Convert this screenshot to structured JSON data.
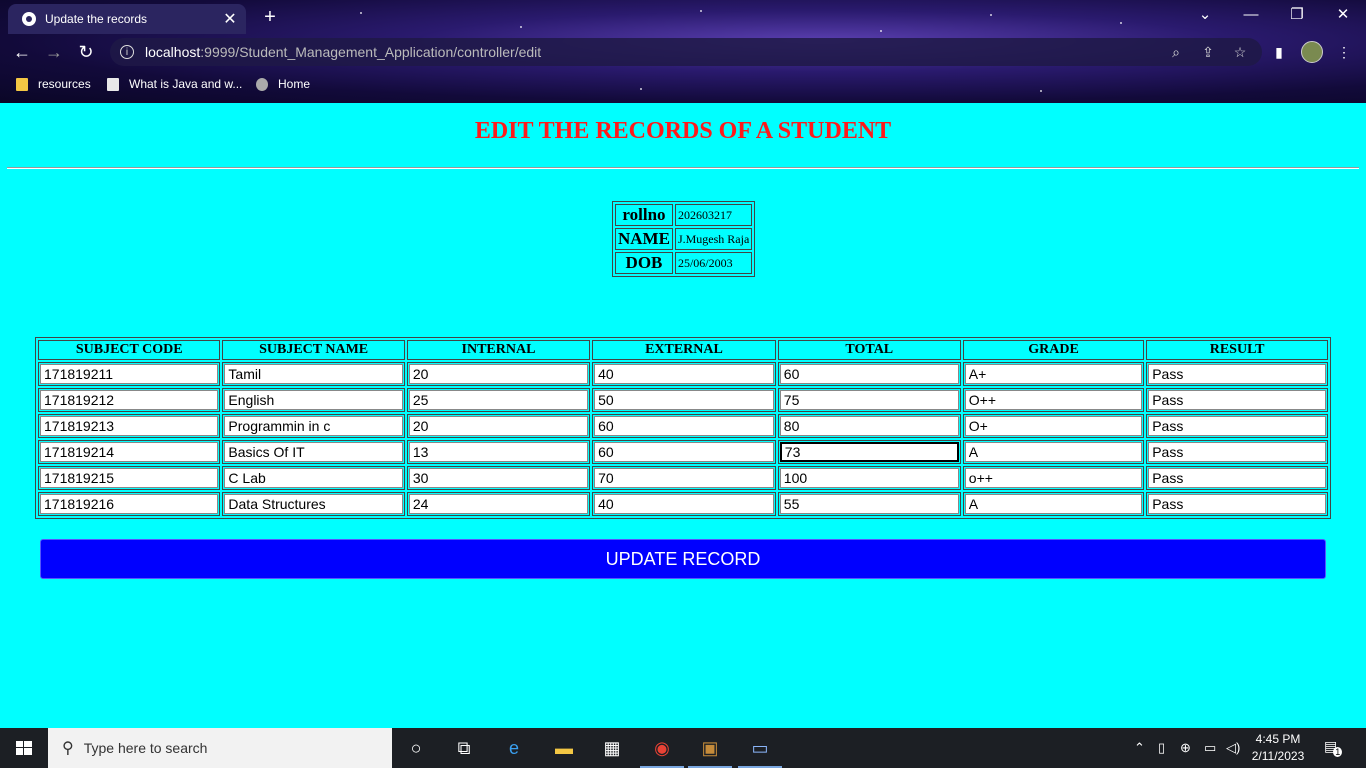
{
  "browser": {
    "tab_title": "Update the records",
    "url_host": "localhost",
    "url_rest": ":9999/Student_Management_Application/controller/edit",
    "bookmarks": [
      "resources",
      "What is Java and w...",
      "Home"
    ]
  },
  "page": {
    "heading": "EDIT THE RECORDS OF A STUDENT",
    "student": [
      {
        "label": "rollno",
        "value": "202603217"
      },
      {
        "label": "NAME",
        "value": "J.Mugesh Raja"
      },
      {
        "label": "DOB",
        "value": "25/06/2003"
      }
    ],
    "columns": [
      "SUBJECT CODE",
      "SUBJECT NAME",
      "INTERNAL",
      "EXTERNAL",
      "TOTAL",
      "GRADE",
      "RESULT"
    ],
    "rows": [
      [
        "171819211",
        "Tamil",
        "20",
        "40",
        "60",
        "A+",
        "Pass"
      ],
      [
        "171819212",
        "English",
        "25",
        "50",
        "75",
        "O++",
        "Pass"
      ],
      [
        "171819213",
        "Programmin in c",
        "20",
        "60",
        "80",
        "O+",
        "Pass"
      ],
      [
        "171819214",
        "Basics Of IT",
        "13",
        "60",
        "73",
        "A",
        "Pass"
      ],
      [
        "171819215",
        "C Lab",
        "30",
        "70",
        "100",
        "o++",
        "Pass"
      ],
      [
        "171819216",
        "Data Structures",
        "24",
        "40",
        "55",
        "A",
        "Pass"
      ]
    ],
    "button_label": "UPDATE RECORD"
  },
  "taskbar": {
    "search_placeholder": "Type here to search",
    "time": "4:45 PM",
    "date": "2/11/2023",
    "notification_count": "1"
  },
  "colors": {
    "page_background": "#00ffff",
    "heading": "#ff1a1a",
    "button": "#0000ff"
  }
}
